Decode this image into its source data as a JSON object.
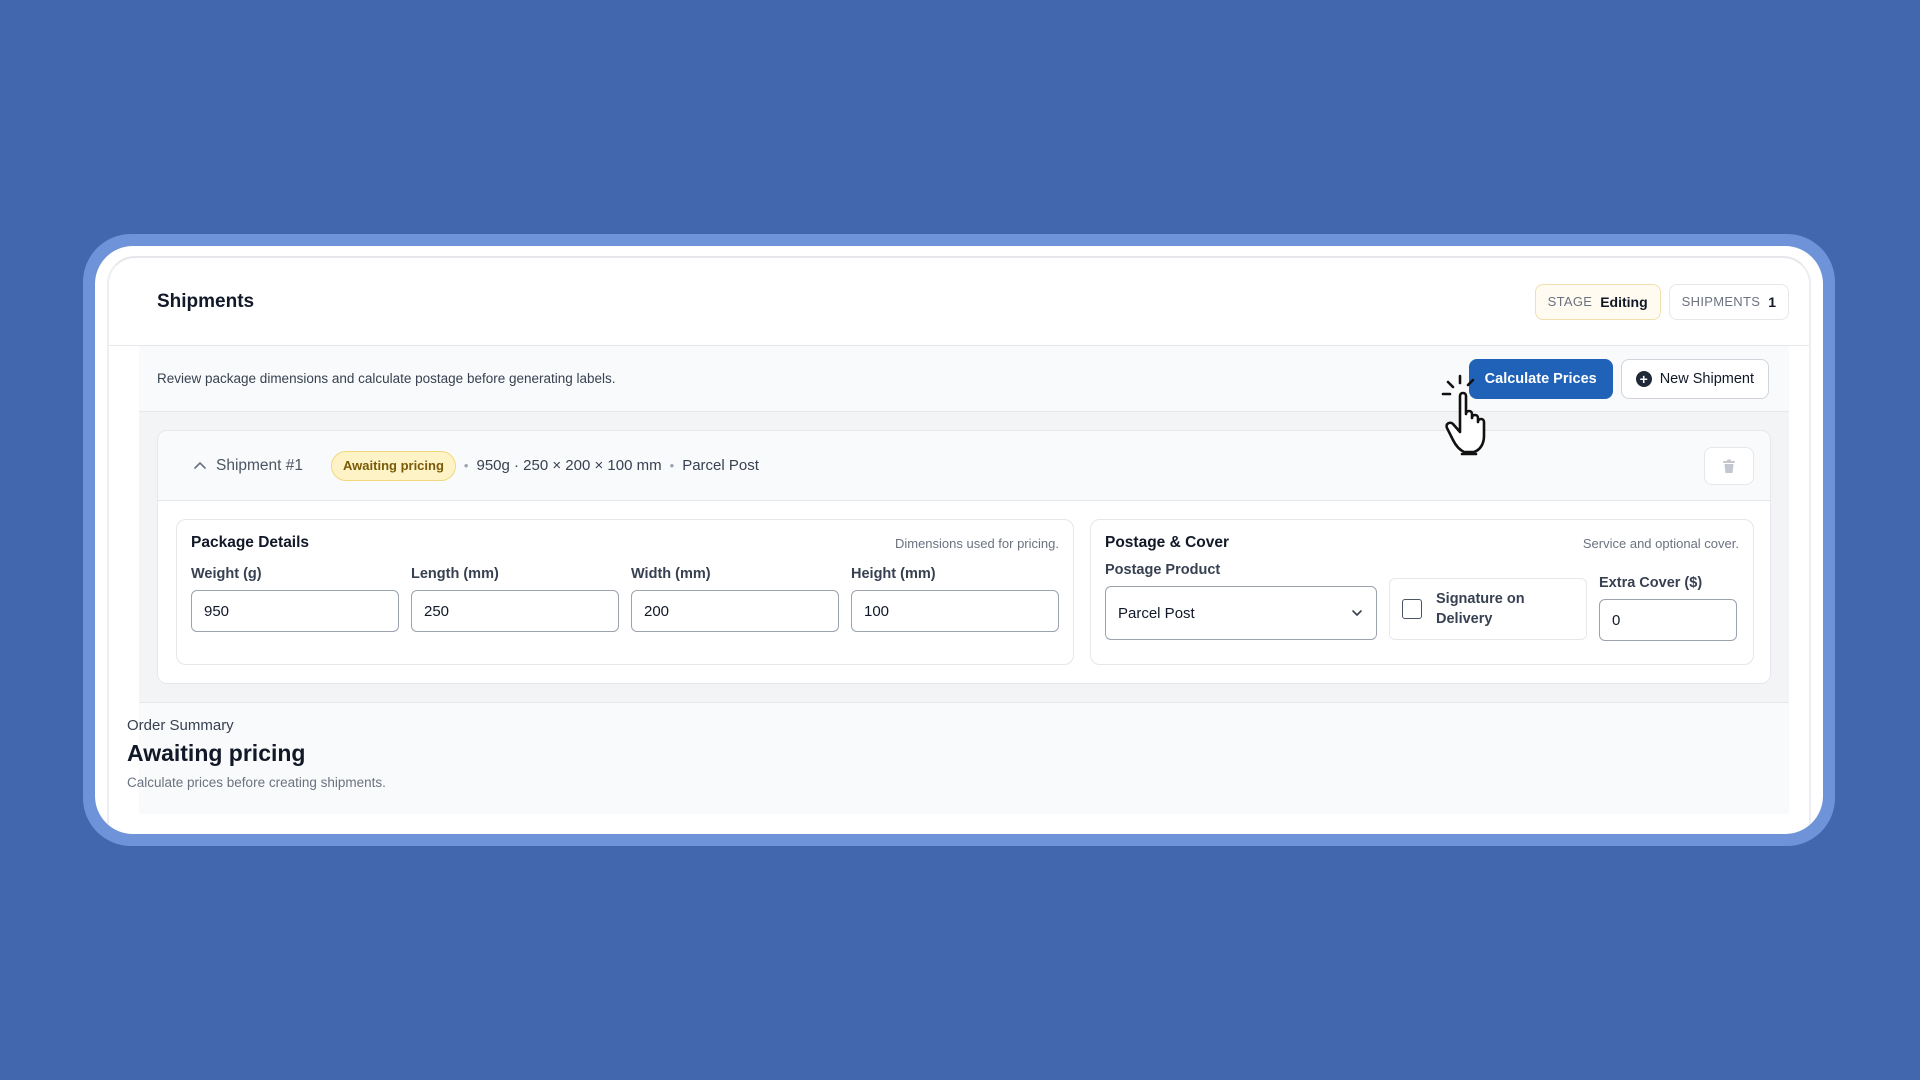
{
  "header": {
    "title": "Shipments",
    "stage_key": "STAGE",
    "stage_value": "Editing",
    "shipments_key": "SHIPMENTS",
    "shipments_value": "1"
  },
  "toolbar": {
    "description": "Review package dimensions and calculate postage before generating labels.",
    "calculate_label": "Calculate Prices",
    "new_shipment_label": "New Shipment"
  },
  "shipment": {
    "name": "Shipment #1",
    "status": "Awaiting pricing",
    "summary_dims": "950g · 250 × 200 × 100 mm",
    "summary_product": "Parcel Post",
    "package": {
      "title": "Package Details",
      "note": "Dimensions used for pricing.",
      "fields": [
        {
          "label": "Weight (g)",
          "value": "950"
        },
        {
          "label": "Length (mm)",
          "value": "250"
        },
        {
          "label": "Width (mm)",
          "value": "200"
        },
        {
          "label": "Height (mm)",
          "value": "100"
        }
      ]
    },
    "postage": {
      "title": "Postage & Cover",
      "note": "Service and optional cover.",
      "product_label": "Postage Product",
      "product_value": "Parcel Post",
      "signature_label": "Signature on Delivery",
      "signature_checked": false,
      "extra_cover_label": "Extra Cover ($)",
      "extra_cover_value": "0"
    }
  },
  "order_summary": {
    "label": "Order Summary",
    "title": "Awaiting pricing",
    "note": "Calculate prices before creating shipments."
  },
  "colors": {
    "background": "#4267ae",
    "primary": "#1f62b8",
    "pending_badge": "#fdf3c7"
  }
}
